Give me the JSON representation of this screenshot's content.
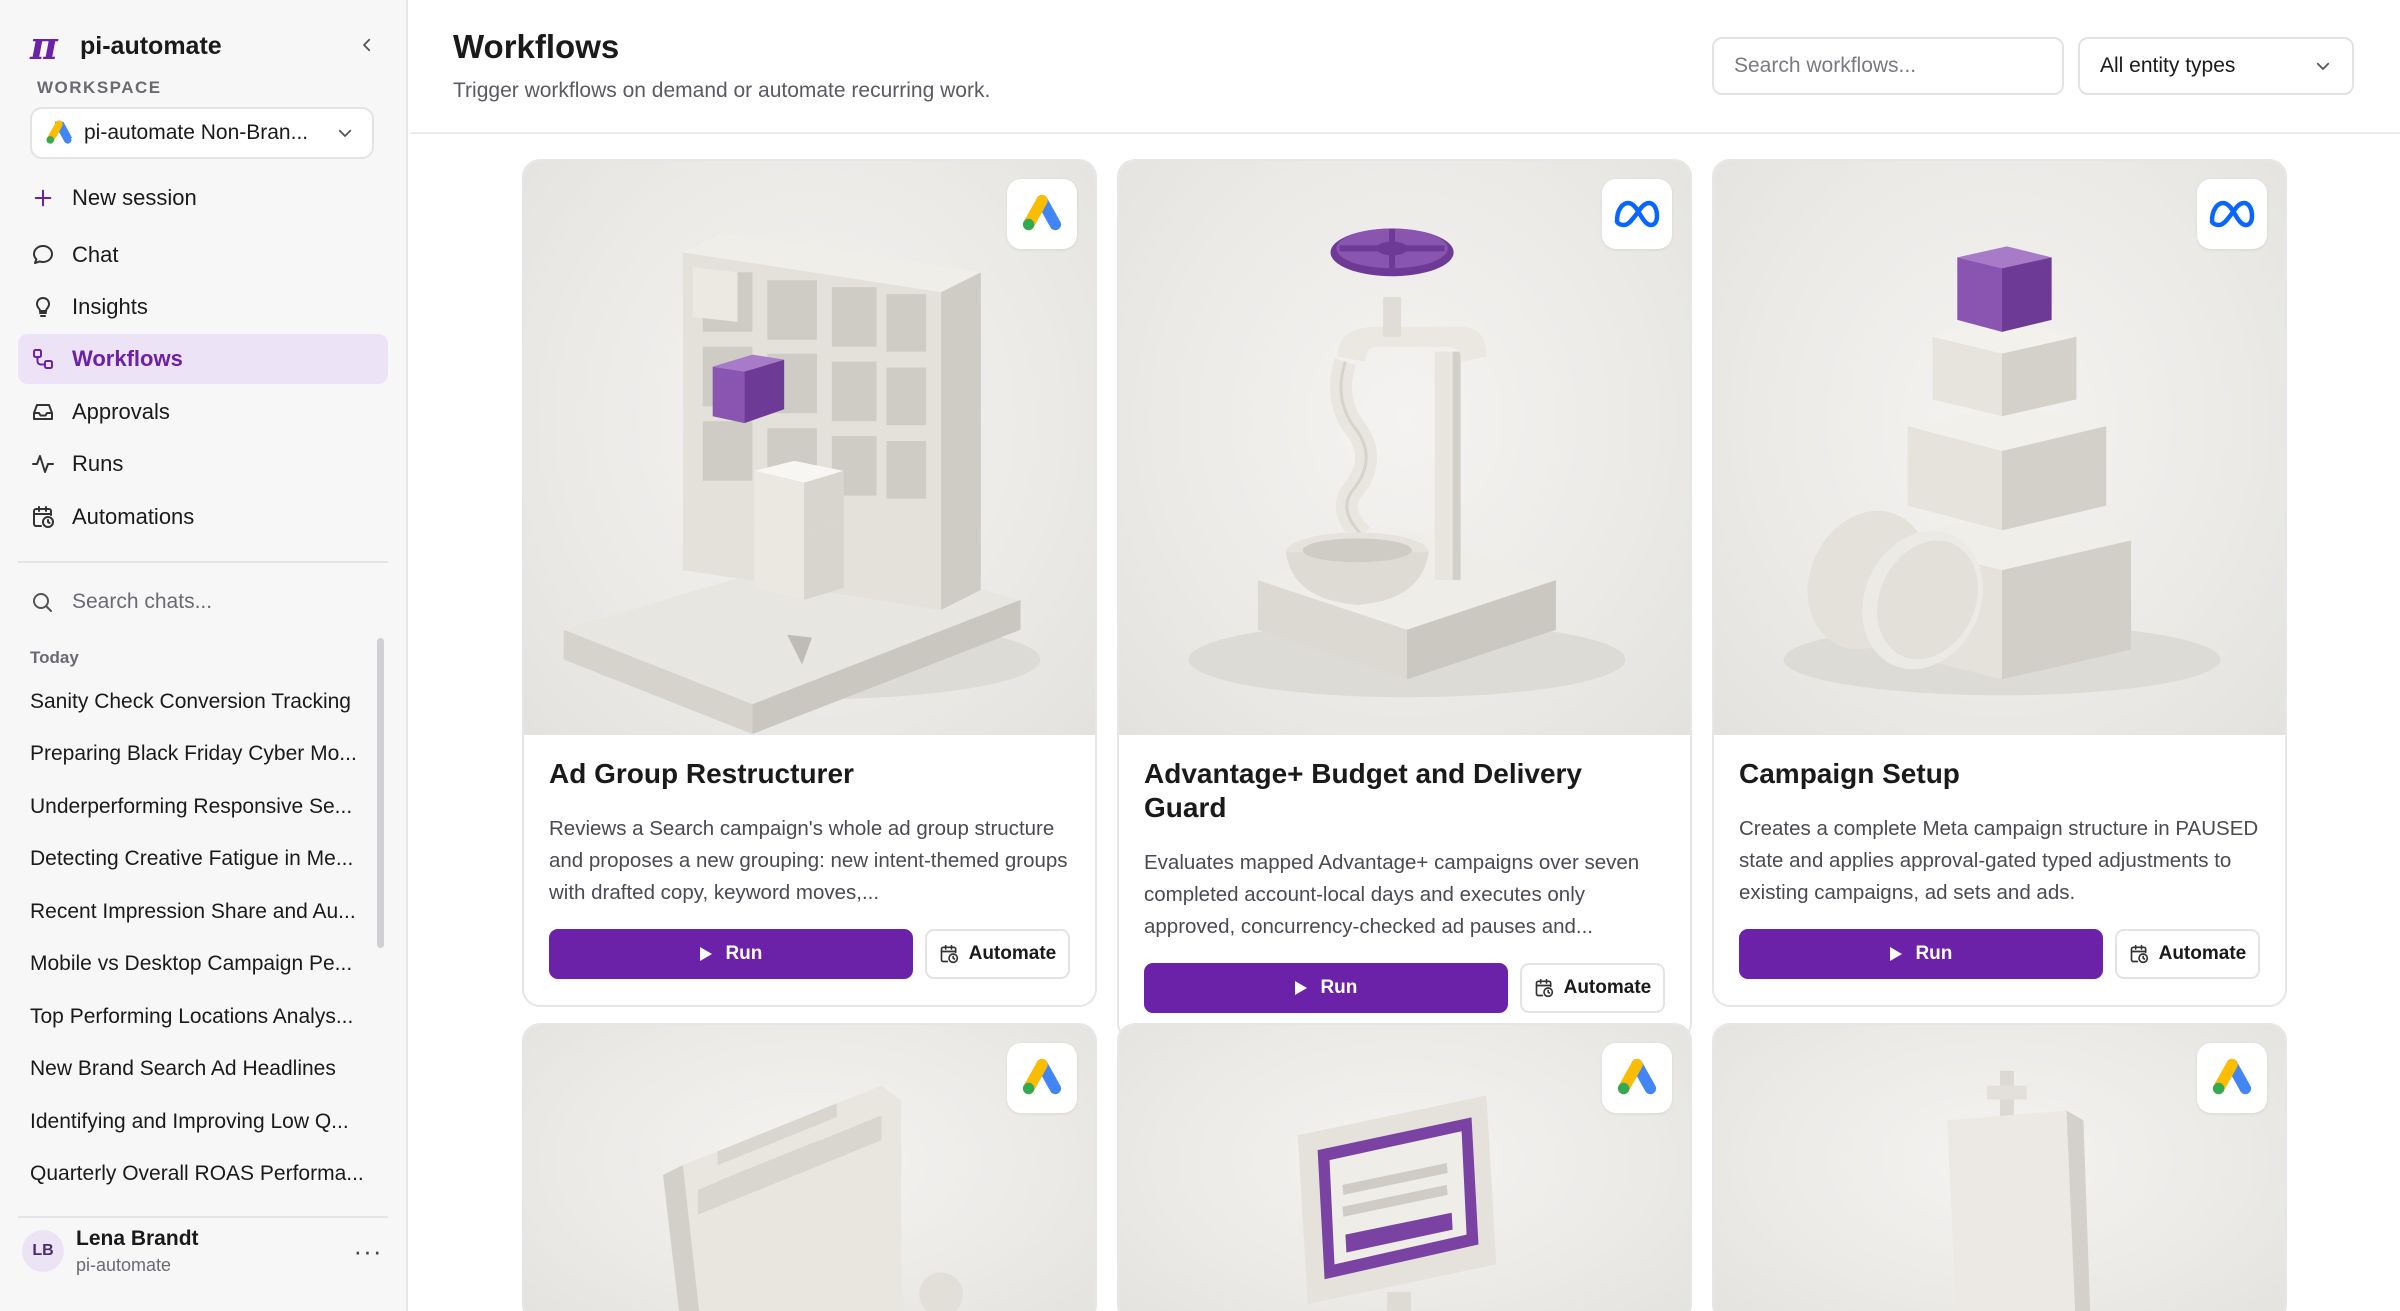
{
  "app": {
    "name": "pi-automate",
    "logo_glyph": "π"
  },
  "sidebar": {
    "workspace_label": "WORKSPACE",
    "workspace_name": "pi-automate Non-Bran...",
    "new_session": "New session",
    "nav": {
      "chat": "Chat",
      "insights": "Insights",
      "workflows": "Workflows",
      "approvals": "Approvals",
      "runs": "Runs",
      "automations": "Automations"
    },
    "search_placeholder": "Search chats...",
    "today_label": "Today",
    "chats": [
      "Sanity Check Conversion Tracking",
      "Preparing Black Friday Cyber Mo...",
      "Underperforming Responsive Se...",
      "Detecting Creative Fatigue in Me...",
      "Recent Impression Share and Au...",
      "Mobile vs Desktop Campaign Pe...",
      "Top Performing Locations Analys...",
      "New Brand Search Ad Headlines",
      "Identifying and Improving Low Q...",
      "Quarterly Overall ROAS Performa..."
    ],
    "user": {
      "initials": "LB",
      "name": "Lena Brandt",
      "org": "pi-automate",
      "more": "···"
    }
  },
  "header": {
    "title": "Workflows",
    "subtitle": "Trigger workflows on demand or automate recurring work.",
    "search_placeholder": "Search workflows...",
    "entity_filter": "All entity types"
  },
  "cards": [
    {
      "title": "Ad Group Restructurer",
      "description": "Reviews a Search campaign's whole ad group structure and proposes a new grouping: new intent-themed groups with drafted copy, keyword moves,...",
      "platform": "google-ads",
      "run_label": "Run",
      "automate_label": "Automate"
    },
    {
      "title": "Advantage+ Budget and Delivery Guard",
      "description": "Evaluates mapped Advantage+ campaigns over seven completed account-local days and executes only approved, concurrency-checked ad pauses and...",
      "platform": "meta",
      "run_label": "Run",
      "automate_label": "Automate"
    },
    {
      "title": "Campaign Setup",
      "description": "Creates a complete Meta campaign structure in PAUSED state and applies approval-gated typed adjustments to existing campaigns, ad sets and ads.",
      "platform": "meta",
      "run_label": "Run",
      "automate_label": "Automate"
    },
    {
      "platform": "google-ads"
    },
    {
      "platform": "google-ads"
    },
    {
      "platform": "google-ads"
    }
  ],
  "colors": {
    "accent": "#6b21a8",
    "accent_light": "#ede3f7",
    "meta_blue": "#0866ff"
  }
}
